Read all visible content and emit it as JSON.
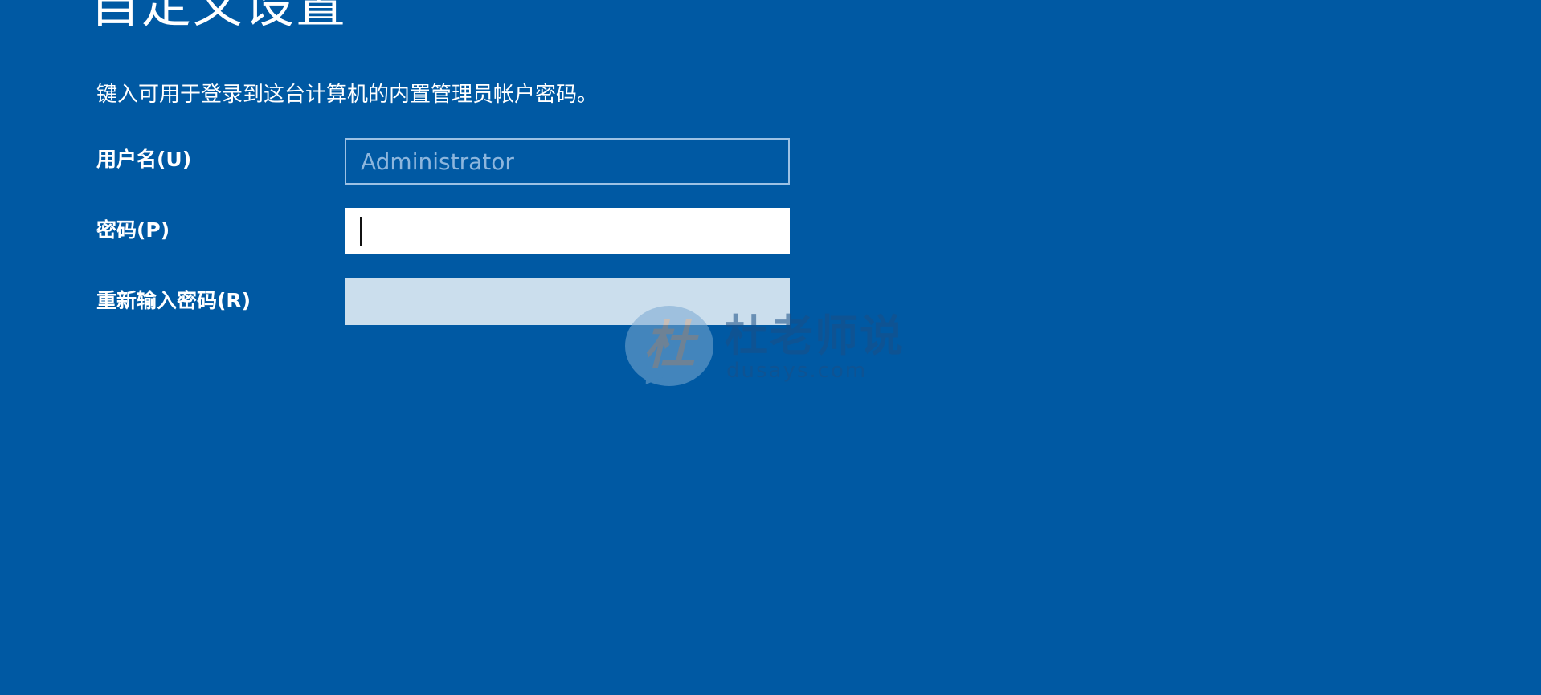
{
  "page": {
    "title": "自定义设置",
    "instruction": "键入可用于登录到这台计算机的内置管理员帐户密码。",
    "background_color": "#0059a3"
  },
  "form": {
    "username": {
      "label": "用户名(U)",
      "placeholder": "Administrator",
      "value": ""
    },
    "password": {
      "label": "密码(P)",
      "value": ""
    },
    "reenter_password": {
      "label": "重新输入密码(R)",
      "value": ""
    }
  },
  "watermark": {
    "badge_glyph": "杜",
    "name": "杜老师说",
    "domain": "dusays.com"
  }
}
